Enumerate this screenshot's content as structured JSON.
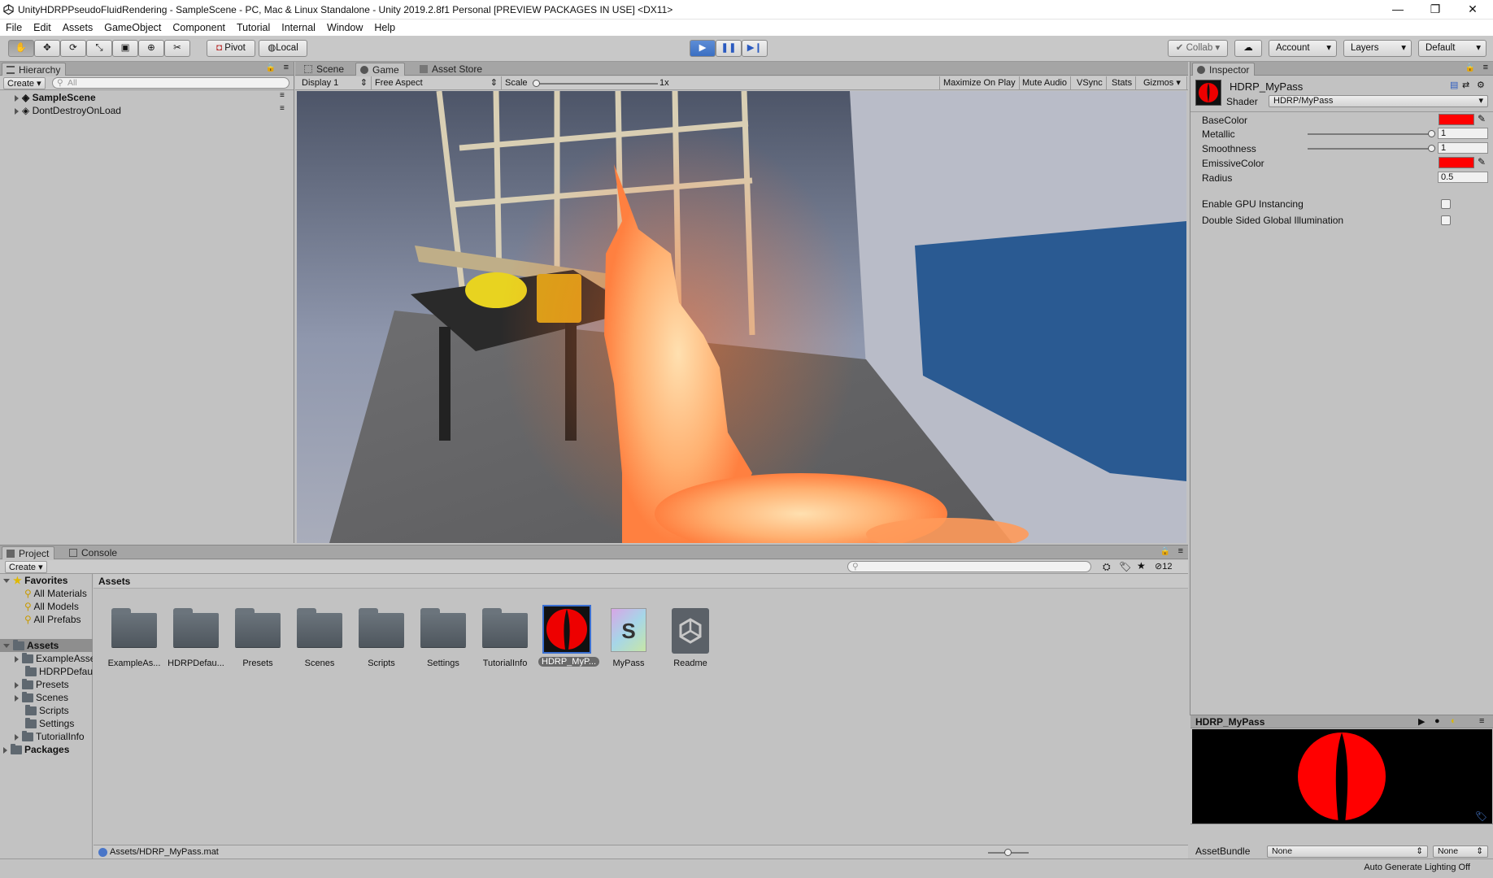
{
  "window": {
    "title": "UnityHDRPPseudoFluidRendering - SampleScene - PC, Mac & Linux Standalone - Unity 2019.2.8f1 Personal [PREVIEW PACKAGES IN USE] <DX11>",
    "minimize": "—",
    "restore": "❐",
    "close": "✕"
  },
  "menu": [
    "File",
    "Edit",
    "Assets",
    "GameObject",
    "Component",
    "Tutorial",
    "Internal",
    "Window",
    "Help"
  ],
  "toolbar": {
    "pivot": "Pivot",
    "local": "Local",
    "collab": "Collab",
    "account": "Account",
    "layers": "Layers",
    "layout": "Default"
  },
  "hierarchy": {
    "tab": "Hierarchy",
    "create": "Create",
    "search_placeholder": "All",
    "items": [
      {
        "label": "SampleScene"
      },
      {
        "label": "DontDestroyOnLoad"
      }
    ]
  },
  "center_tabs": {
    "scene": "Scene",
    "game": "Game",
    "asset_store": "Asset Store"
  },
  "game_bar": {
    "display": "Display 1",
    "aspect": "Free Aspect",
    "scale_label": "Scale",
    "scale_value": "1x",
    "maximize": "Maximize On Play",
    "mute": "Mute Audio",
    "vsync": "VSync",
    "stats": "Stats",
    "gizmos": "Gizmos"
  },
  "inspector": {
    "tab": "Inspector",
    "material_name": "HDRP_MyPass",
    "shader_label": "Shader",
    "shader_value": "HDRP/MyPass",
    "props": {
      "base_color": "BaseColor",
      "metallic": "Metallic",
      "metallic_value": "1",
      "smoothness": "Smoothness",
      "smoothness_value": "1",
      "emissive": "EmissiveColor",
      "radius": "Radius",
      "radius_value": "0.5",
      "gpu_instancing": "Enable GPU Instancing",
      "double_sided_gi": "Double Sided Global Illumination"
    },
    "preview_title": "HDRP_MyPass",
    "asset_bundle_label": "AssetBundle",
    "asset_bundle_value": "None",
    "asset_bundle_variant": "None"
  },
  "project": {
    "tab": "Project",
    "console_tab": "Console",
    "create": "Create",
    "item_count": "12",
    "favorites": "Favorites",
    "favorite_items": [
      "All Materials",
      "All Models",
      "All Prefabs"
    ],
    "assets_root": "Assets",
    "asset_tree": [
      "ExampleAssets",
      "HDRPDefaultResources",
      "Presets",
      "Scenes",
      "Scripts",
      "Settings",
      "TutorialInfo"
    ],
    "packages": "Packages",
    "breadcrumb": "Assets",
    "grid": [
      {
        "label": "ExampleAs..."
      },
      {
        "label": "HDRPDefau..."
      },
      {
        "label": "Presets"
      },
      {
        "label": "Scenes"
      },
      {
        "label": "Scripts"
      },
      {
        "label": "Settings"
      },
      {
        "label": "TutorialInfo"
      },
      {
        "label": "HDRP_MyP..."
      },
      {
        "label": "MyPass"
      },
      {
        "label": "Readme"
      }
    ],
    "selected_path": "Assets/HDRP_MyPass.mat"
  },
  "status": {
    "lighting": "Auto Generate Lighting Off"
  },
  "colors": {
    "accent_blue": "#3b6fc2",
    "material_red": "#ff0000"
  }
}
